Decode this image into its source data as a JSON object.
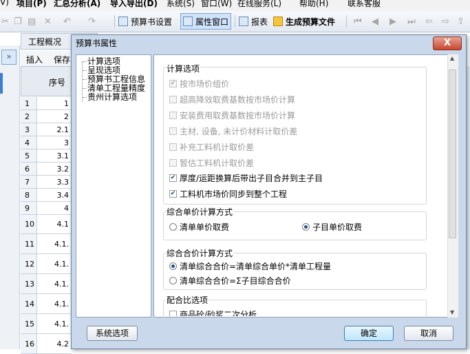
{
  "menu": [
    "V)",
    "项目(P)",
    "汇总分析(A)",
    "导入导出(D)",
    "系统(S)",
    "窗口(W)",
    "在线服务(L)",
    "帮助(H)",
    "联系客服"
  ],
  "toolbar": {
    "budget_settings": "预算书设置",
    "property_window": "属性窗口",
    "report": "报表",
    "generate_budget": "生成预算文件"
  },
  "background": {
    "tab_overview": "工程概况",
    "insert": "插入",
    "save": "保存",
    "col_seq": "序号",
    "rows": [
      {
        "n": "1",
        "v": "1"
      },
      {
        "n": "2",
        "v": "2"
      },
      {
        "n": "3",
        "v": "2.1"
      },
      {
        "n": "4",
        "v": "3"
      },
      {
        "n": "5",
        "v": "3.1"
      },
      {
        "n": "6",
        "v": "3.2"
      },
      {
        "n": "7",
        "v": "3.3"
      },
      {
        "n": "8",
        "v": "3.4"
      },
      {
        "n": "9",
        "v": "4"
      },
      {
        "n": "10",
        "v": "4.1"
      },
      {
        "n": "11",
        "v": "4.1."
      },
      {
        "n": "12",
        "v": "4.1."
      },
      {
        "n": "13",
        "v": "4.1."
      },
      {
        "n": "14",
        "v": "4.1."
      },
      {
        "n": "15",
        "v": "4.1."
      },
      {
        "n": "16",
        "v": "4.2"
      }
    ]
  },
  "dialog": {
    "title": "预算书属性",
    "close_label": "X",
    "tree": [
      "计算选项",
      "呈现选项",
      "预算书工程信息",
      "清单工程量精度",
      "贵州计算选项"
    ],
    "calc_group": {
      "title": "计算选项",
      "options": [
        {
          "label": "按市场价组价",
          "checked": true,
          "disabled": true
        },
        {
          "label": "超高降效取费基数按市场价计算",
          "checked": false,
          "disabled": true
        },
        {
          "label": "安装费用取费基数按市场价计算",
          "checked": false,
          "disabled": true
        },
        {
          "label": "主材, 设备, 未计价材料计取价差",
          "checked": false,
          "disabled": true
        },
        {
          "label": "补充工料机计取价差",
          "checked": false,
          "disabled": true
        },
        {
          "label": "暂估工料机计取价差",
          "checked": false,
          "disabled": true
        },
        {
          "label": "厚度/运距换算后带出子目合并到主子目",
          "checked": true,
          "disabled": false
        },
        {
          "label": "工料机市场价同步到整个工程",
          "checked": true,
          "disabled": false
        }
      ]
    },
    "unit_price_group": {
      "title": "综合单价计算方式",
      "opt1": "清单单价取费",
      "opt2": "子目单价取费"
    },
    "total_price_group": {
      "title": "综合合价计算方式",
      "opt1": "清单综合合价=清单综合单价*清单工程量",
      "opt2": "清单综合合价=Σ子目综合合价"
    },
    "mix_group": {
      "title": "配合比选项",
      "partial": "商品砼/砂浆二次分析"
    },
    "buttons": {
      "system": "系统选项",
      "ok": "确定",
      "cancel": "取消"
    }
  }
}
